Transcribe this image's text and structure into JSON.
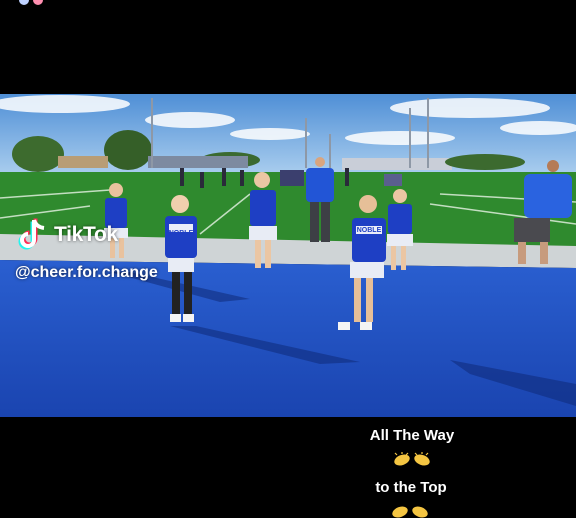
{
  "watermark": {
    "brand": "TikTok",
    "handle": "@cheer.for.change",
    "logo_icon": "tiktok-logo-icon"
  },
  "captions": {
    "line1": "All The Way",
    "line2": "to the Top",
    "emoji_icon": "clapping-hands-icon"
  },
  "uniform": {
    "text": "NOBLE"
  },
  "colors": {
    "turf_blue": "#1f52c8",
    "field_green": "#2f8a2e",
    "sky": "#6fa7dc",
    "uniform_blue": "#1e3fc4"
  }
}
